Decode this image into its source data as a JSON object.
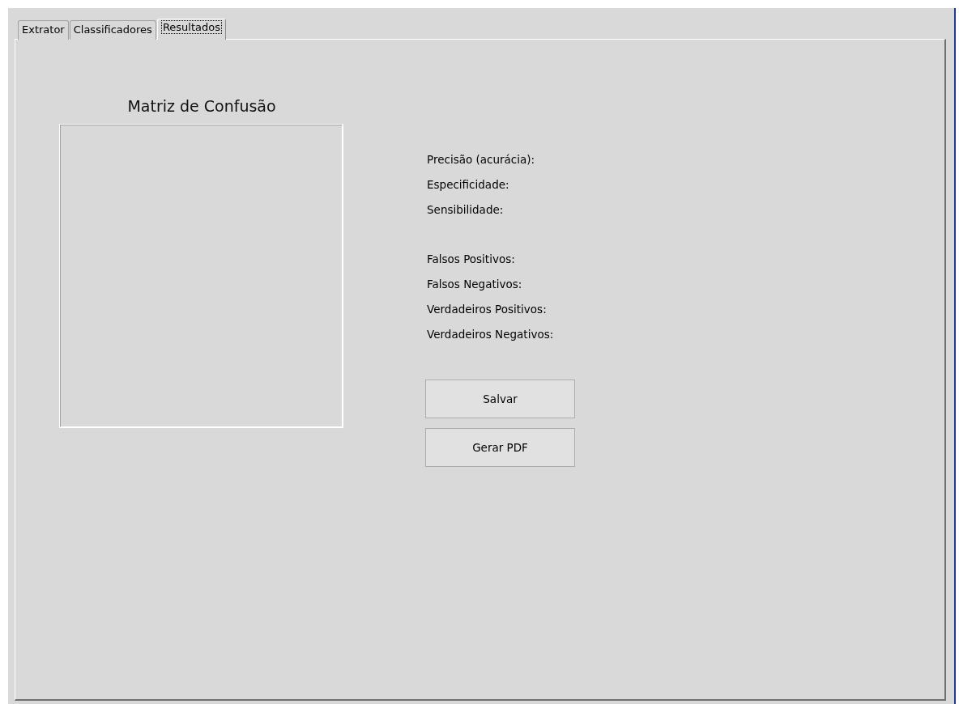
{
  "tabs": [
    {
      "label": "Extrator",
      "selected": false
    },
    {
      "label": "Classificadores",
      "selected": false
    },
    {
      "label": "Resultados",
      "selected": true
    }
  ],
  "matrix": {
    "title": "Matriz de Confusão"
  },
  "metric_groups": [
    [
      "Precisão (acurácia):",
      "Especificidade:",
      "Sensibilidade:"
    ],
    [
      "Falsos Positivos:",
      "Falsos Negativos:",
      "Verdadeiros Positivos:",
      "Verdadeiros Negativos:"
    ]
  ],
  "buttons": [
    "Salvar",
    "Gerar PDF"
  ]
}
